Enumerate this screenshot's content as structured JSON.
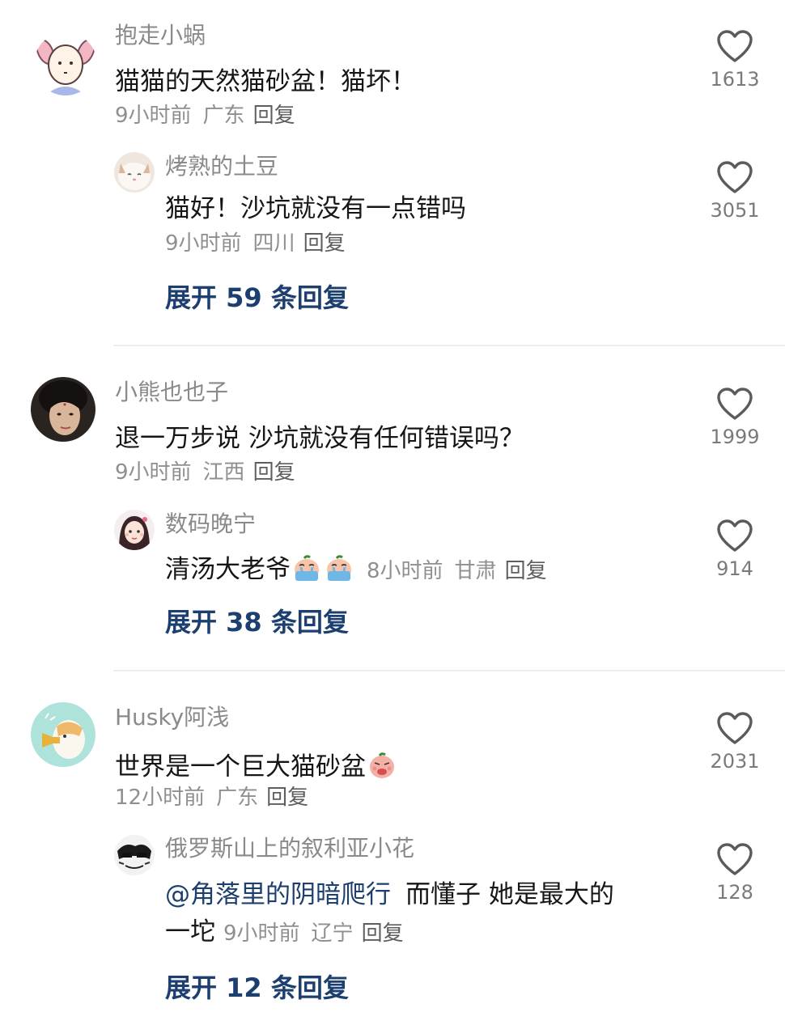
{
  "like_icon": "heart-outline-icon",
  "threads": [
    {
      "name": "抱走小蜗",
      "content": "猫猫的天然猫砂盆！猫坏！",
      "time": "9小时前",
      "location": "广东",
      "reply": "回复",
      "likes": "1613",
      "sub": {
        "name": "烤熟的土豆",
        "content": "猫好！沙坑就没有一点错吗",
        "time": "9小时前",
        "location": "四川",
        "reply": "回复",
        "likes": "3051"
      },
      "expand": "展开 59 条回复"
    },
    {
      "name": "小熊也也子",
      "content": "退一万步说 沙坑就没有任何错误吗？",
      "time": "9小时前",
      "location": "江西",
      "reply": "回复",
      "likes": "1999",
      "sub": {
        "name": "数码晚宁",
        "content": "清汤大老爷",
        "emoji": "crying-peach-emoji",
        "time": "8小时前",
        "location": "甘肃",
        "reply": "回复",
        "likes": "914"
      },
      "expand": "展开 38 条回复"
    },
    {
      "name": "Husky阿浅",
      "content": "世界是一个巨大猫砂盆",
      "emoji": "peach-face-emoji",
      "time": "12小时前",
      "location": "广东",
      "reply": "回复",
      "likes": "2031",
      "sub": {
        "name": "俄罗斯山上的叙利亚小花",
        "mention": "@角落里的阴暗爬行",
        "content_line1": "而懂子 她是最大的",
        "content_line2": "一坨",
        "time": "9小时前",
        "location": "辽宁",
        "reply": "回复",
        "likes": "128"
      },
      "expand": "展开 12 条回复"
    }
  ]
}
